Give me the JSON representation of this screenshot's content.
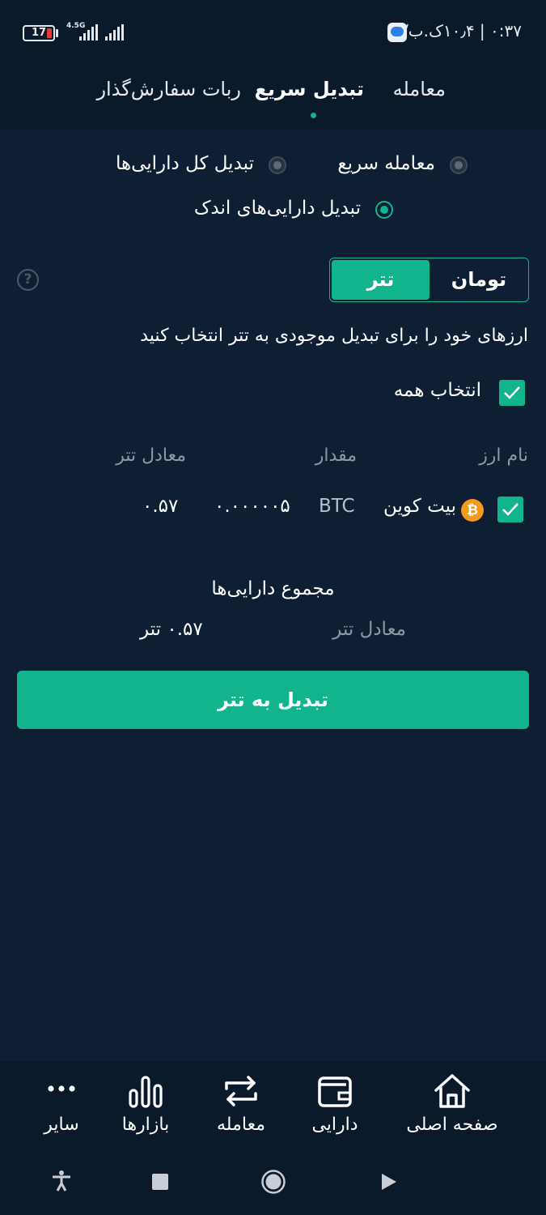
{
  "status_bar": {
    "time": "۰:۳۷ | ۱۰٫۴ک.ب/ث",
    "battery": "17",
    "network": "4.5G"
  },
  "top_tabs": [
    {
      "label": "معامله",
      "active": false
    },
    {
      "label": "تبدیل سریع",
      "active": true
    },
    {
      "label": "ربات سفارش‌گذار",
      "active": false
    }
  ],
  "modes": {
    "quick_trade": "معامله سریع",
    "convert_all": "تبدیل کل دارایی‌ها",
    "convert_small": "تبدیل دارایی‌های اندک",
    "selected": "convert_small"
  },
  "toggle": {
    "toman": "تومان",
    "tether": "تتر",
    "selected": "tether"
  },
  "help_symbol": "?",
  "instruction": "ارزهای خود را برای تبدیل موجودی به تتر انتخاب کنید",
  "select_all": {
    "label": "انتخاب همه",
    "checked": true
  },
  "table": {
    "headers": {
      "name": "نام ارز",
      "amount": "مقدار",
      "equivalent": "معادل تتر"
    },
    "rows": [
      {
        "checked": true,
        "icon_symbol": "₿",
        "icon": "bitcoin-icon",
        "name": "بیت کوین",
        "amount": "۰.۰۰۰۰۰۵",
        "symbol": "BTC",
        "equivalent": "۰.۵۷"
      }
    ]
  },
  "total": {
    "title": "مجموع دارایی‌ها",
    "label": "معادل تتر",
    "value": "۰.۵۷ تتر"
  },
  "convert_button": "تبدیل به تتر",
  "bottom_nav": [
    {
      "label": "صفحه اصلی",
      "icon": "home-icon"
    },
    {
      "label": "دارایی",
      "icon": "wallet-icon"
    },
    {
      "label": "معامله",
      "icon": "swap-icon"
    },
    {
      "label": "بازارها",
      "icon": "markets-icon"
    },
    {
      "label": "سایر",
      "icon": "more-icon"
    }
  ],
  "colors": {
    "background": "#0f1f33",
    "bar": "#0b1a2b",
    "accent": "#12b48e",
    "muted_text": "#8e99a6",
    "bitcoin": "#f39a1e"
  }
}
